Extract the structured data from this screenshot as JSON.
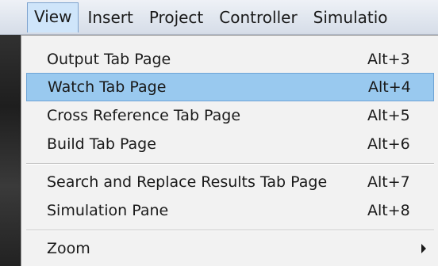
{
  "menubar": {
    "items": [
      {
        "label": "View",
        "active": true
      },
      {
        "label": "Insert"
      },
      {
        "label": "Project"
      },
      {
        "label": "Controller"
      },
      {
        "label": "Simulatio"
      }
    ]
  },
  "dropdown": {
    "items": [
      {
        "label": "Output Tab Page",
        "shortcut": "Alt+3"
      },
      {
        "label": "Watch Tab Page",
        "shortcut": "Alt+4",
        "highlighted": true
      },
      {
        "label": "Cross Reference Tab Page",
        "shortcut": "Alt+5"
      },
      {
        "label": "Build Tab Page",
        "shortcut": "Alt+6"
      },
      {
        "label": "Search and Replace Results Tab Page",
        "shortcut": "Alt+7"
      },
      {
        "label": "Simulation Pane",
        "shortcut": "Alt+8"
      },
      {
        "label": "Zoom",
        "shortcut": "",
        "has_submenu": true
      }
    ]
  },
  "colors": {
    "highlight": "#99c9ef",
    "highlight_border": "#6ea4d6",
    "menu_background": "#f2f2f2",
    "menubar_active": "#cfe5fa"
  },
  "icons": {
    "submenu": "chevron-right-icon"
  }
}
